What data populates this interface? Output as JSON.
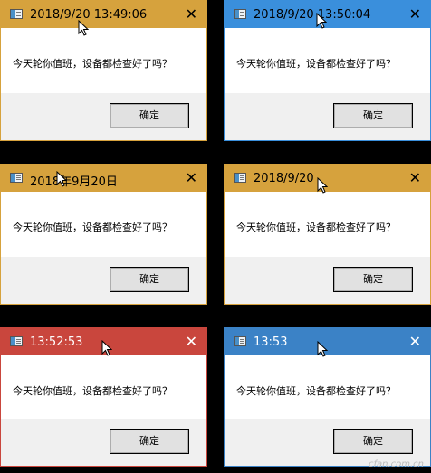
{
  "colors": {
    "yellow": "#d6a23d",
    "blue": "#3a8fdc",
    "red": "#c9463d",
    "blue_dark": "#3b82c6"
  },
  "message": "今天轮你值班，设备都检查好了吗？",
  "ok_label": "确定",
  "dialogs": [
    {
      "title": "2018/9/20 13:49:06"
    },
    {
      "title": "2018/9/20 13:50:04"
    },
    {
      "title": "2018年9月20日"
    },
    {
      "title": "2018/9/20"
    },
    {
      "title": "13:52:53"
    },
    {
      "title": "13:53"
    }
  ],
  "watermark": "cfan.com.cn"
}
